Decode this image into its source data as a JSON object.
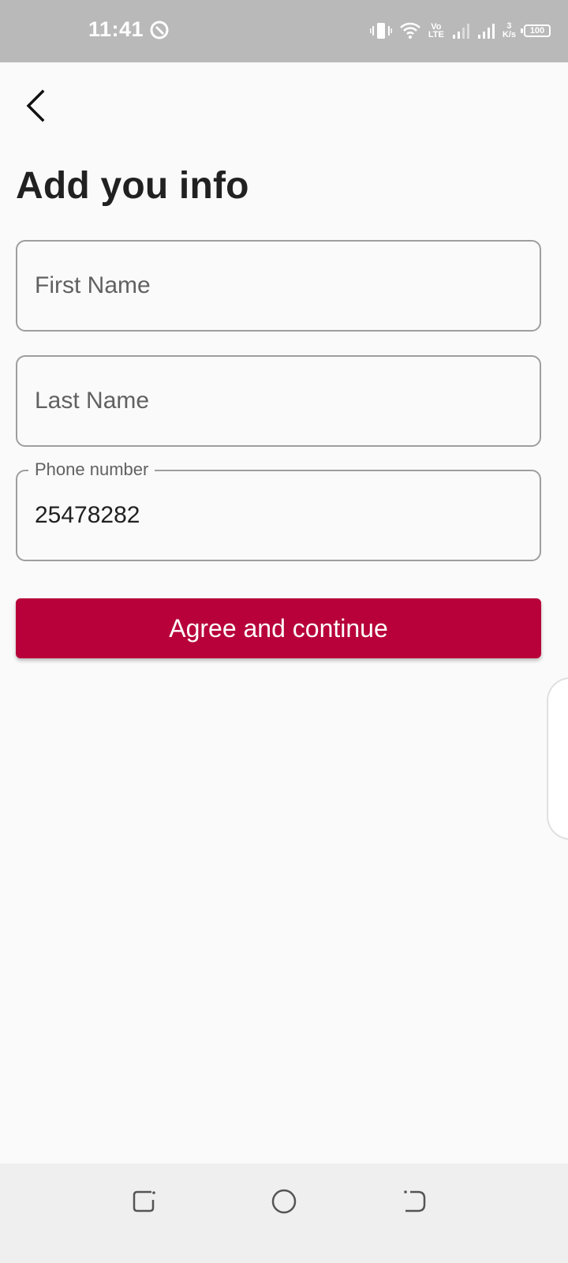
{
  "status_bar": {
    "time": "11:41",
    "network_label_top": "Vo",
    "network_label_bottom": "LTE",
    "speed_value": "3",
    "speed_unit": "K/s",
    "battery": "100"
  },
  "header": {
    "title": "Add you info"
  },
  "form": {
    "first_name": {
      "placeholder": "First Name",
      "value": ""
    },
    "last_name": {
      "placeholder": "Last Name",
      "value": ""
    },
    "phone": {
      "label": "Phone number",
      "value": "25478282"
    }
  },
  "actions": {
    "continue_label": "Agree and continue"
  },
  "colors": {
    "primary": "#b8003a",
    "background": "#fafafa",
    "status_bar": "#b9b9b9"
  }
}
